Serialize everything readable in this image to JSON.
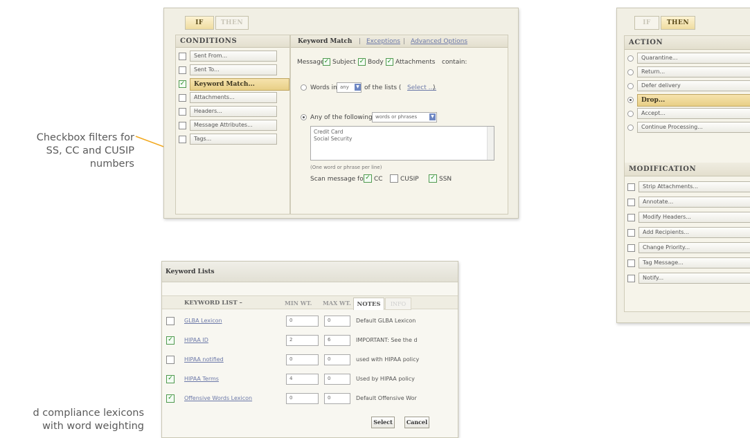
{
  "captions": {
    "filters_line1": "Checkbox filters for",
    "filters_line2": "SS, CC and CUSIP",
    "filters_line3": "numbers",
    "lexicons_line1": "d compliance lexicons",
    "lexicons_line2": "with word weighting"
  },
  "colors": {
    "callout_line": "#f2a81d",
    "selected_gold": "#e8cf86",
    "panel_bg": "#f1efe4"
  },
  "conditions_panel": {
    "tabs": {
      "if": "IF",
      "then": "THEN"
    },
    "header": "CONDITIONS",
    "items": [
      {
        "label": "Sent From...",
        "checked": false,
        "selected": false
      },
      {
        "label": "Sent To...",
        "checked": false,
        "selected": false
      },
      {
        "label": "Keyword Match...",
        "checked": true,
        "selected": true
      },
      {
        "label": "Attachments...",
        "checked": false,
        "selected": false
      },
      {
        "label": "Headers...",
        "checked": false,
        "selected": false
      },
      {
        "label": "Message Attributes...",
        "checked": false,
        "selected": false
      },
      {
        "label": "Tags...",
        "checked": false,
        "selected": false
      }
    ],
    "detail": {
      "tab_active": "Keyword Match",
      "sep1": "|",
      "tab_exceptions": "Exceptions",
      "sep2": "|",
      "tab_advanced": "Advanced Options",
      "message_label": "Message",
      "subject_label": "Subject",
      "body_label": "Body",
      "attachments_label": "Attachments",
      "contain_label": "contain:",
      "words_in_prefix": "Words in",
      "words_in_select": "any",
      "words_in_suffix": "of the lists (",
      "select_link": "Select ....",
      "words_in_close": ")",
      "any_of_following": "Any of the following",
      "phrase_select": "words or phrases",
      "textarea_lines": [
        "Credit Card",
        "Social Security"
      ],
      "hint": "(One word or phrase per line)",
      "scan_label": "Scan message for:",
      "scan_options": [
        {
          "label": "CC",
          "checked": true
        },
        {
          "label": "CUSIP",
          "checked": false
        },
        {
          "label": "SSN",
          "checked": true
        }
      ]
    }
  },
  "action_panel": {
    "tabs": {
      "if": "IF",
      "then": "THEN"
    },
    "action_header": "ACTION",
    "actions": [
      {
        "label": "Quarantine...",
        "selected": false
      },
      {
        "label": "Return...",
        "selected": false
      },
      {
        "label": "Defer delivery",
        "selected": false
      },
      {
        "label": "Drop...",
        "selected": true
      },
      {
        "label": "Accept...",
        "selected": false
      },
      {
        "label": "Continue Processing...",
        "selected": false
      }
    ],
    "modification_header": "MODIFICATION",
    "modifications": [
      "Strip Attachments...",
      "Annotate...",
      "Modify Headers...",
      "Add Recipients...",
      "Change Priority...",
      "Tag Message...",
      "Notify..."
    ]
  },
  "keyword_lists": {
    "title": "Keyword Lists",
    "col_list": "KEYWORD LIST –",
    "col_min": "MIN WT.",
    "col_max": "MAX WT.",
    "tab_notes": "NOTES",
    "tab_info": "INFO",
    "rows": [
      {
        "name": "GLBA Lexicon",
        "checked": false,
        "min": "0",
        "max": "0",
        "note": "Default GLBA Lexicon"
      },
      {
        "name": "HIPAA ID",
        "checked": true,
        "min": "2",
        "max": "6",
        "note": "IMPORTANT: See the d"
      },
      {
        "name": "HIPAA notified",
        "checked": false,
        "min": "0",
        "max": "0",
        "note": "used with HIPAA policy"
      },
      {
        "name": "HIPAA Terms",
        "checked": true,
        "min": "4",
        "max": "0",
        "note": "Used by HIPAA policy"
      },
      {
        "name": "Offensive Words Lexicon",
        "checked": true,
        "min": "0",
        "max": "0",
        "note": "Default Offensive Wor"
      }
    ],
    "select_button": "Select",
    "cancel_button": "Cancel"
  }
}
